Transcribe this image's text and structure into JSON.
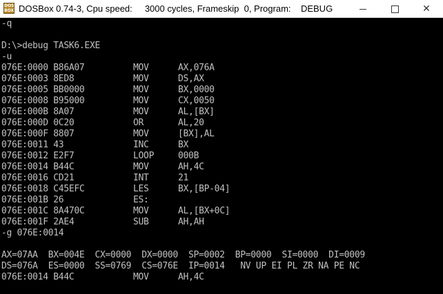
{
  "window": {
    "title": "DOSBox 0.74-3, Cpu speed:     3000 cycles, Frameskip  0, Program:    DEBUG",
    "app_icon_text": "DOS BOX",
    "minimize": "minimize",
    "maximize": "maximize",
    "close": "close"
  },
  "console": {
    "lines": [
      {
        "text": "-q"
      },
      {
        "text": ""
      },
      {
        "text": "D:\\>debug TASK6.EXE"
      },
      {
        "text": "-u"
      },
      {
        "addr": "076E:0000 B86A07",
        "op": "MOV",
        "args": "AX,076A"
      },
      {
        "addr": "076E:0003 8ED8",
        "op": "MOV",
        "args": "DS,AX"
      },
      {
        "addr": "076E:0005 BB0000",
        "op": "MOV",
        "args": "BX,0000"
      },
      {
        "addr": "076E:0008 B95000",
        "op": "MOV",
        "args": "CX,0050"
      },
      {
        "addr": "076E:000B 8A07",
        "op": "MOV",
        "args": "AL,[BX]"
      },
      {
        "addr": "076E:000D 0C20",
        "op": "OR",
        "args": "AL,20"
      },
      {
        "addr": "076E:000F 8807",
        "op": "MOV",
        "args": "[BX],AL"
      },
      {
        "addr": "076E:0011 43",
        "op": "INC",
        "args": "BX"
      },
      {
        "addr": "076E:0012 E2F7",
        "op": "LOOP",
        "args": "000B"
      },
      {
        "addr": "076E:0014 B44C",
        "op": "MOV",
        "args": "AH,4C"
      },
      {
        "addr": "076E:0016 CD21",
        "op": "INT",
        "args": "21"
      },
      {
        "addr": "076E:0018 C45EFC",
        "op": "LES",
        "args": "BX,[BP-04]"
      },
      {
        "addr": "076E:001B 26",
        "op": "ES:",
        "args": ""
      },
      {
        "addr": "076E:001C 8A470C",
        "op": "MOV",
        "args": "AL,[BX+0C]"
      },
      {
        "addr": "076E:001F 2AE4",
        "op": "SUB",
        "args": "AH,AH"
      },
      {
        "text": "-g 076E:0014"
      },
      {
        "text": ""
      },
      {
        "text": "AX=07AA  BX=004E  CX=0000  DX=0000  SP=0002  BP=0000  SI=0000  DI=0009"
      },
      {
        "text": "DS=076A  ES=0000  SS=0769  CS=076E  IP=0014   NV UP EI PL ZR NA PE NC"
      },
      {
        "addr": "076E:0014 B44C",
        "op": "MOV",
        "args": "AH,4C"
      }
    ]
  }
}
